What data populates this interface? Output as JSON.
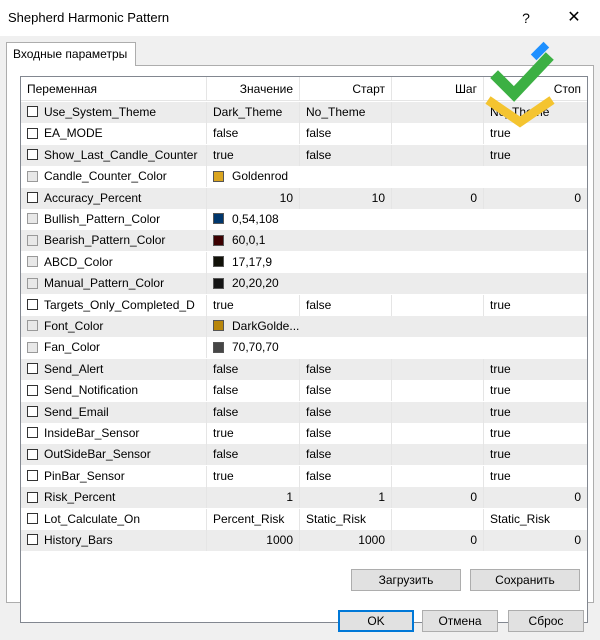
{
  "window": {
    "title": "Shepherd Harmonic Pattern",
    "help_glyph": "?",
    "close_glyph": "✕"
  },
  "tabs": [
    {
      "label": "Входные параметры"
    }
  ],
  "table": {
    "headers": [
      "Переменная",
      "Значение",
      "Старт",
      "Шаг",
      "Стоп"
    ],
    "rows": [
      {
        "name": "Use_System_Theme",
        "value": "Dark_Theme",
        "start": "No_Theme",
        "step": "",
        "stop": "No_Theme",
        "type": "text"
      },
      {
        "name": "EA_MODE",
        "value": "false",
        "start": "false",
        "step": "",
        "stop": "true",
        "type": "text"
      },
      {
        "name": "Show_Last_Candle_Counter",
        "value": "true",
        "start": "false",
        "step": "",
        "stop": "true",
        "type": "text"
      },
      {
        "name": "Candle_Counter_Color",
        "value": "Goldenrod",
        "swatch": "#daa520",
        "type": "color"
      },
      {
        "name": "Accuracy_Percent",
        "value": "10",
        "start": "10",
        "step": "0",
        "stop": "0",
        "type": "num"
      },
      {
        "name": "Bullish_Pattern_Color",
        "value": "0,54,108",
        "swatch": "#00366c",
        "type": "color"
      },
      {
        "name": "Bearish_Pattern_Color",
        "value": "60,0,1",
        "swatch": "#3c0001",
        "type": "color"
      },
      {
        "name": "ABCD_Color",
        "value": "17,17,9",
        "swatch": "#111109",
        "type": "color"
      },
      {
        "name": "Manual_Pattern_Color",
        "value": "20,20,20",
        "swatch": "#141414",
        "type": "color"
      },
      {
        "name": "Targets_Only_Completed_D",
        "value": "true",
        "start": "false",
        "step": "",
        "stop": "true",
        "type": "text"
      },
      {
        "name": "Font_Color",
        "value": "DarkGolde...",
        "swatch": "#b8860b",
        "type": "color"
      },
      {
        "name": "Fan_Color",
        "value": "70,70,70",
        "swatch": "#464646",
        "type": "color"
      },
      {
        "name": "Send_Alert",
        "value": "false",
        "start": "false",
        "step": "",
        "stop": "true",
        "type": "text"
      },
      {
        "name": "Send_Notification",
        "value": "false",
        "start": "false",
        "step": "",
        "stop": "true",
        "type": "text"
      },
      {
        "name": "Send_Email",
        "value": "false",
        "start": "false",
        "step": "",
        "stop": "true",
        "type": "text"
      },
      {
        "name": "InsideBar_Sensor",
        "value": "true",
        "start": "false",
        "step": "",
        "stop": "true",
        "type": "text"
      },
      {
        "name": "OutSideBar_Sensor",
        "value": "false",
        "start": "false",
        "step": "",
        "stop": "true",
        "type": "text"
      },
      {
        "name": "PinBar_Sensor",
        "value": "true",
        "start": "false",
        "step": "",
        "stop": "true",
        "type": "text"
      },
      {
        "name": "Risk_Percent",
        "value": "1",
        "start": "1",
        "step": "0",
        "stop": "0",
        "type": "num"
      },
      {
        "name": "Lot_Calculate_On",
        "value": "Percent_Risk",
        "start": "Static_Risk",
        "step": "",
        "stop": "Static_Risk",
        "type": "text"
      },
      {
        "name": "History_Bars",
        "value": "1000",
        "start": "1000",
        "step": "0",
        "stop": "0",
        "type": "num"
      }
    ]
  },
  "buttons": {
    "load": "Загрузить",
    "save": "Сохранить",
    "ok": "OK",
    "cancel": "Отмена",
    "reset": "Сброс"
  },
  "colors": {
    "accent": "#0078d7",
    "logo_green": "#3cb043",
    "logo_yellow": "#f4c430",
    "logo_blue": "#1e90ff"
  }
}
